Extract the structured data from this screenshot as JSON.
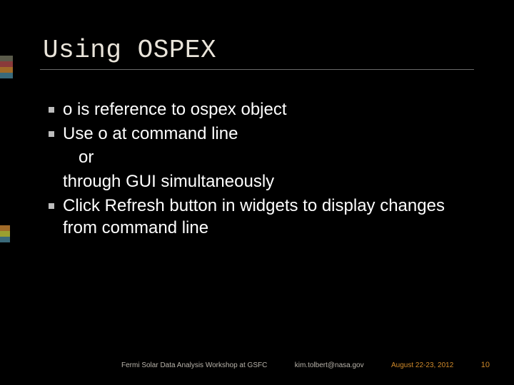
{
  "title": "Using OSPEX",
  "bullets": [
    {
      "type": "bullet",
      "text": "o is reference to ospex object"
    },
    {
      "type": "bullet",
      "text": "Use o at command line"
    },
    {
      "type": "sub",
      "text": "or"
    },
    {
      "type": "sub2",
      "text": "through GUI simultaneously"
    },
    {
      "type": "bullet",
      "text": "Click Refresh button in widgets to display changes from command line"
    }
  ],
  "footer": {
    "venue": "Fermi Solar Data Analysis Workshop at GSFC",
    "email": "kim.tolbert@nasa.gov",
    "date": "August 22-23, 2012",
    "page": "10"
  }
}
